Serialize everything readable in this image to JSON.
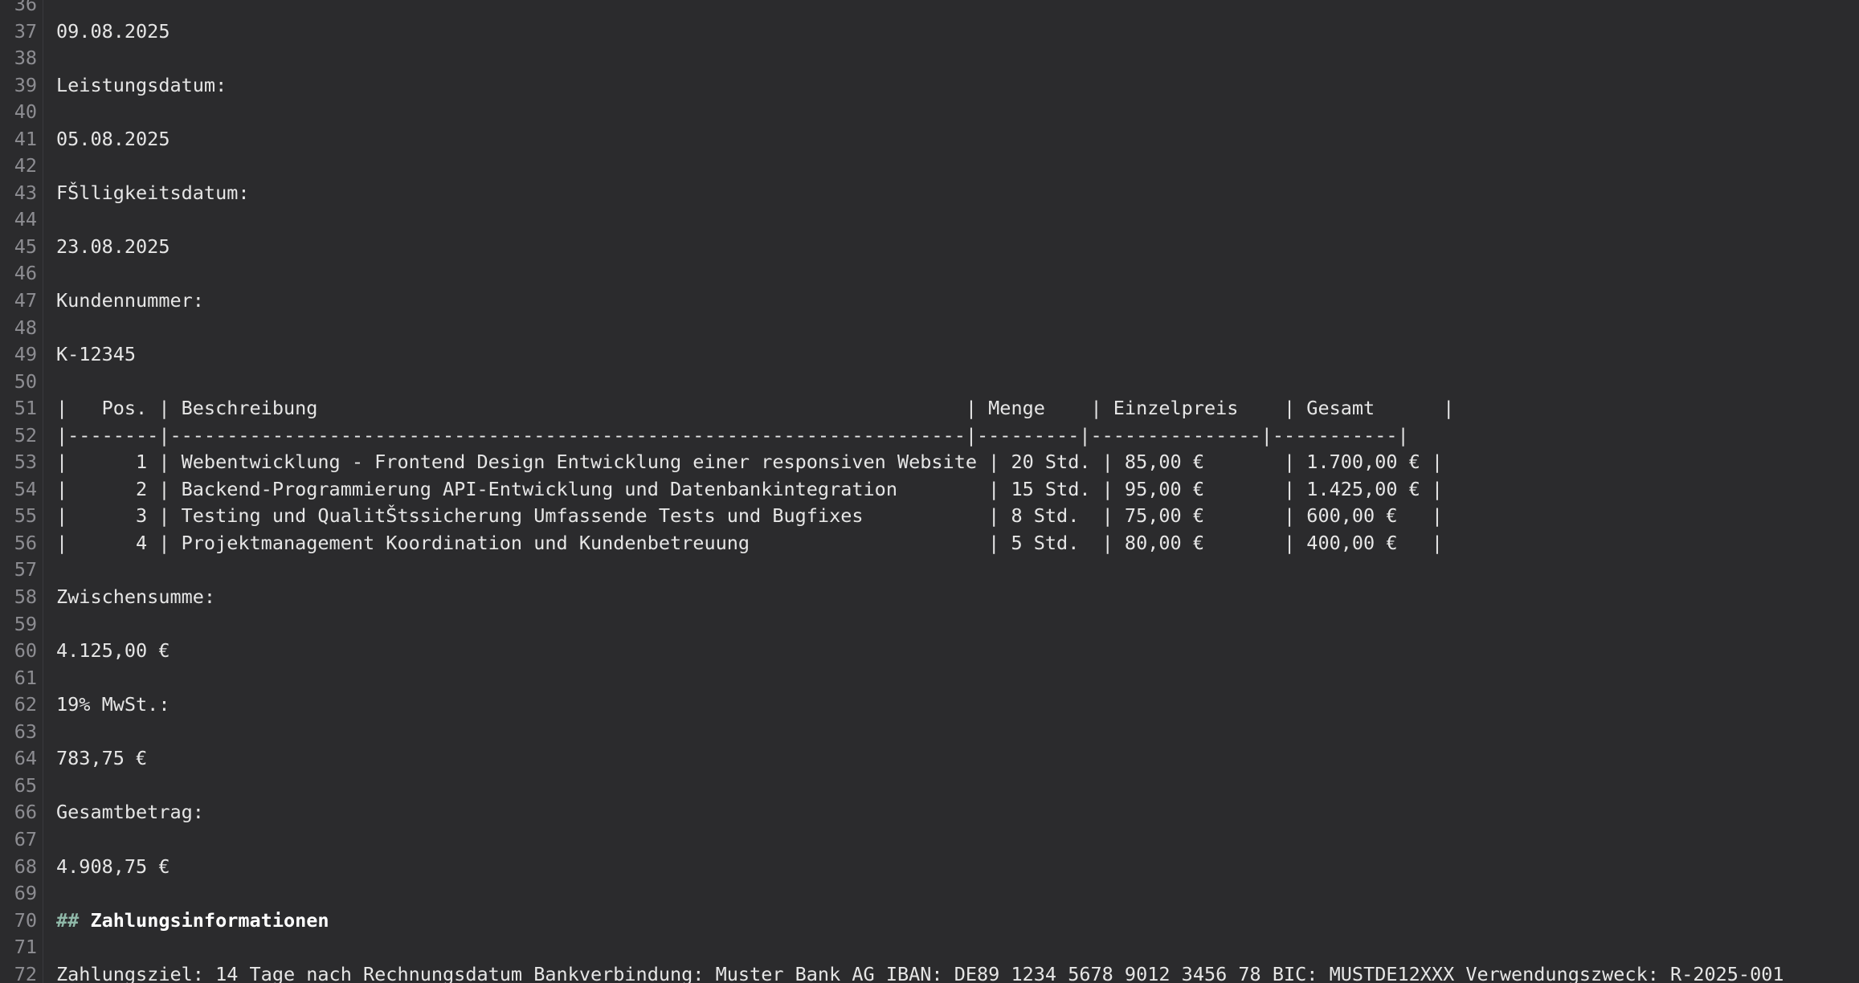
{
  "editor": {
    "lines": [
      {
        "n": "36",
        "text": ""
      },
      {
        "n": "37",
        "text": "09.08.2025"
      },
      {
        "n": "38",
        "text": ""
      },
      {
        "n": "39",
        "text": "Leistungsdatum:"
      },
      {
        "n": "40",
        "text": ""
      },
      {
        "n": "41",
        "text": "05.08.2025"
      },
      {
        "n": "42",
        "text": ""
      },
      {
        "n": "43",
        "text": "FŠlligkeitsdatum:"
      },
      {
        "n": "44",
        "text": ""
      },
      {
        "n": "45",
        "text": "23.08.2025"
      },
      {
        "n": "46",
        "text": ""
      },
      {
        "n": "47",
        "text": "Kundennummer:"
      },
      {
        "n": "48",
        "text": ""
      },
      {
        "n": "49",
        "text": "K-12345"
      },
      {
        "n": "50",
        "text": ""
      },
      {
        "n": "51",
        "text": "|   Pos. | Beschreibung                                                         | Menge    | Einzelpreis    | Gesamt      |"
      },
      {
        "n": "52",
        "text": "|--------|----------------------------------------------------------------------|---------|---------------|-----------|"
      },
      {
        "n": "53",
        "text": "|      1 | Webentwicklung - Frontend Design Entwicklung einer responsiven Website | 20 Std. | 85,00 €       | 1.700,00 € |"
      },
      {
        "n": "54",
        "text": "|      2 | Backend-Programmierung API-Entwicklung und Datenbankintegration        | 15 Std. | 95,00 €       | 1.425,00 € |"
      },
      {
        "n": "55",
        "text": "|      3 | Testing und QualitŠtssicherung Umfassende Tests und Bugfixes           | 8 Std.  | 75,00 €       | 600,00 €   |"
      },
      {
        "n": "56",
        "text": "|      4 | Projektmanagement Koordination und Kundenbetreuung                     | 5 Std.  | 80,00 €       | 400,00 €   |"
      },
      {
        "n": "57",
        "text": ""
      },
      {
        "n": "58",
        "text": "Zwischensumme:"
      },
      {
        "n": "59",
        "text": ""
      },
      {
        "n": "60",
        "text": "4.125,00 €"
      },
      {
        "n": "61",
        "text": ""
      },
      {
        "n": "62",
        "text": "19% MwSt.:"
      },
      {
        "n": "63",
        "text": ""
      },
      {
        "n": "64",
        "text": "783,75 €"
      },
      {
        "n": "65",
        "text": ""
      },
      {
        "n": "66",
        "text": "Gesamtbetrag:"
      },
      {
        "n": "67",
        "text": ""
      },
      {
        "n": "68",
        "text": "4.908,75 €"
      },
      {
        "n": "69",
        "text": ""
      },
      {
        "n": "70",
        "text": ""
      },
      {
        "n": "71",
        "text": ""
      },
      {
        "n": "72",
        "text": "Zahlungsziel: 14 Tage nach Rechnungsdatum Bankverbindung: Muster Bank AG IBAN: DE89 1234 5678 9012 3456 78 BIC: MUSTDE12XXX Verwendungszweck: R-2025-001"
      }
    ],
    "heading_line": {
      "marker": "##",
      "title": "Zahlungsinformationen"
    }
  }
}
